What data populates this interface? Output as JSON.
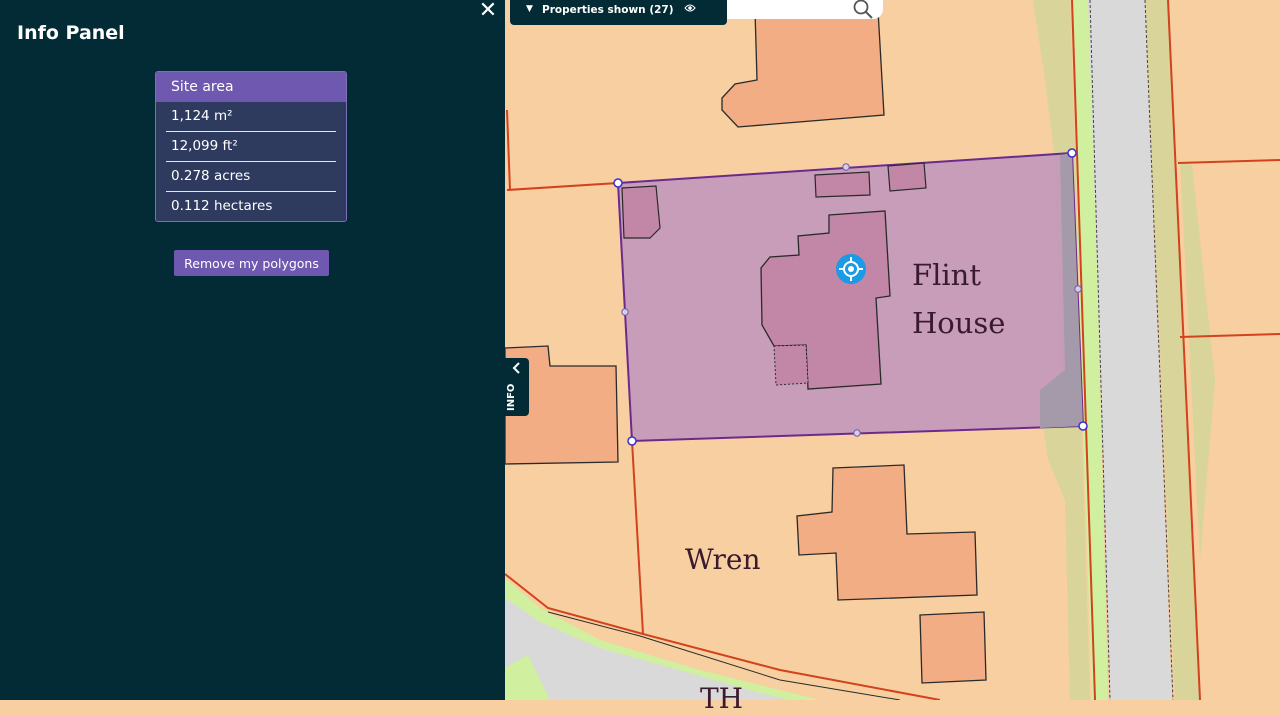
{
  "info_panel": {
    "title": "Info Panel",
    "close_icon": "close-icon",
    "site_area": {
      "header": "Site area",
      "rows": [
        "1,124 m²",
        "12,099 ft²",
        "0.278 acres",
        "0.112 hectares"
      ]
    },
    "remove_button_label": "Remove my polygons"
  },
  "toolbar": {
    "properties_label": "Properties shown (27)",
    "chevron_icon": "chevron-down-icon",
    "eye_icon": "eye-icon"
  },
  "search": {
    "placeholder": "",
    "icon": "search-icon"
  },
  "info_tab": {
    "label": "INFO",
    "icon": "chevron-left-icon"
  },
  "map": {
    "labels": {
      "flint_line1": "Flint",
      "flint_line2": "House",
      "wren": "Wren",
      "road_partial": "TH"
    },
    "polygon_center_icon": "crosshair-icon"
  },
  "colors": {
    "panel_bg": "#022b35",
    "accent_purple": "#6e58b0",
    "map_land": "#f7cfa0",
    "building_fill": "#f2ad84",
    "boundary_red": "#d2421e",
    "polygon_fill": "#c49aba",
    "polygon_stroke": "#6a2b8c",
    "road_gray": "#d9d9d9",
    "verge_green": "#d0ef9f",
    "verge_olive": "#d9d49a",
    "center_handle": "#1b9ae6"
  }
}
